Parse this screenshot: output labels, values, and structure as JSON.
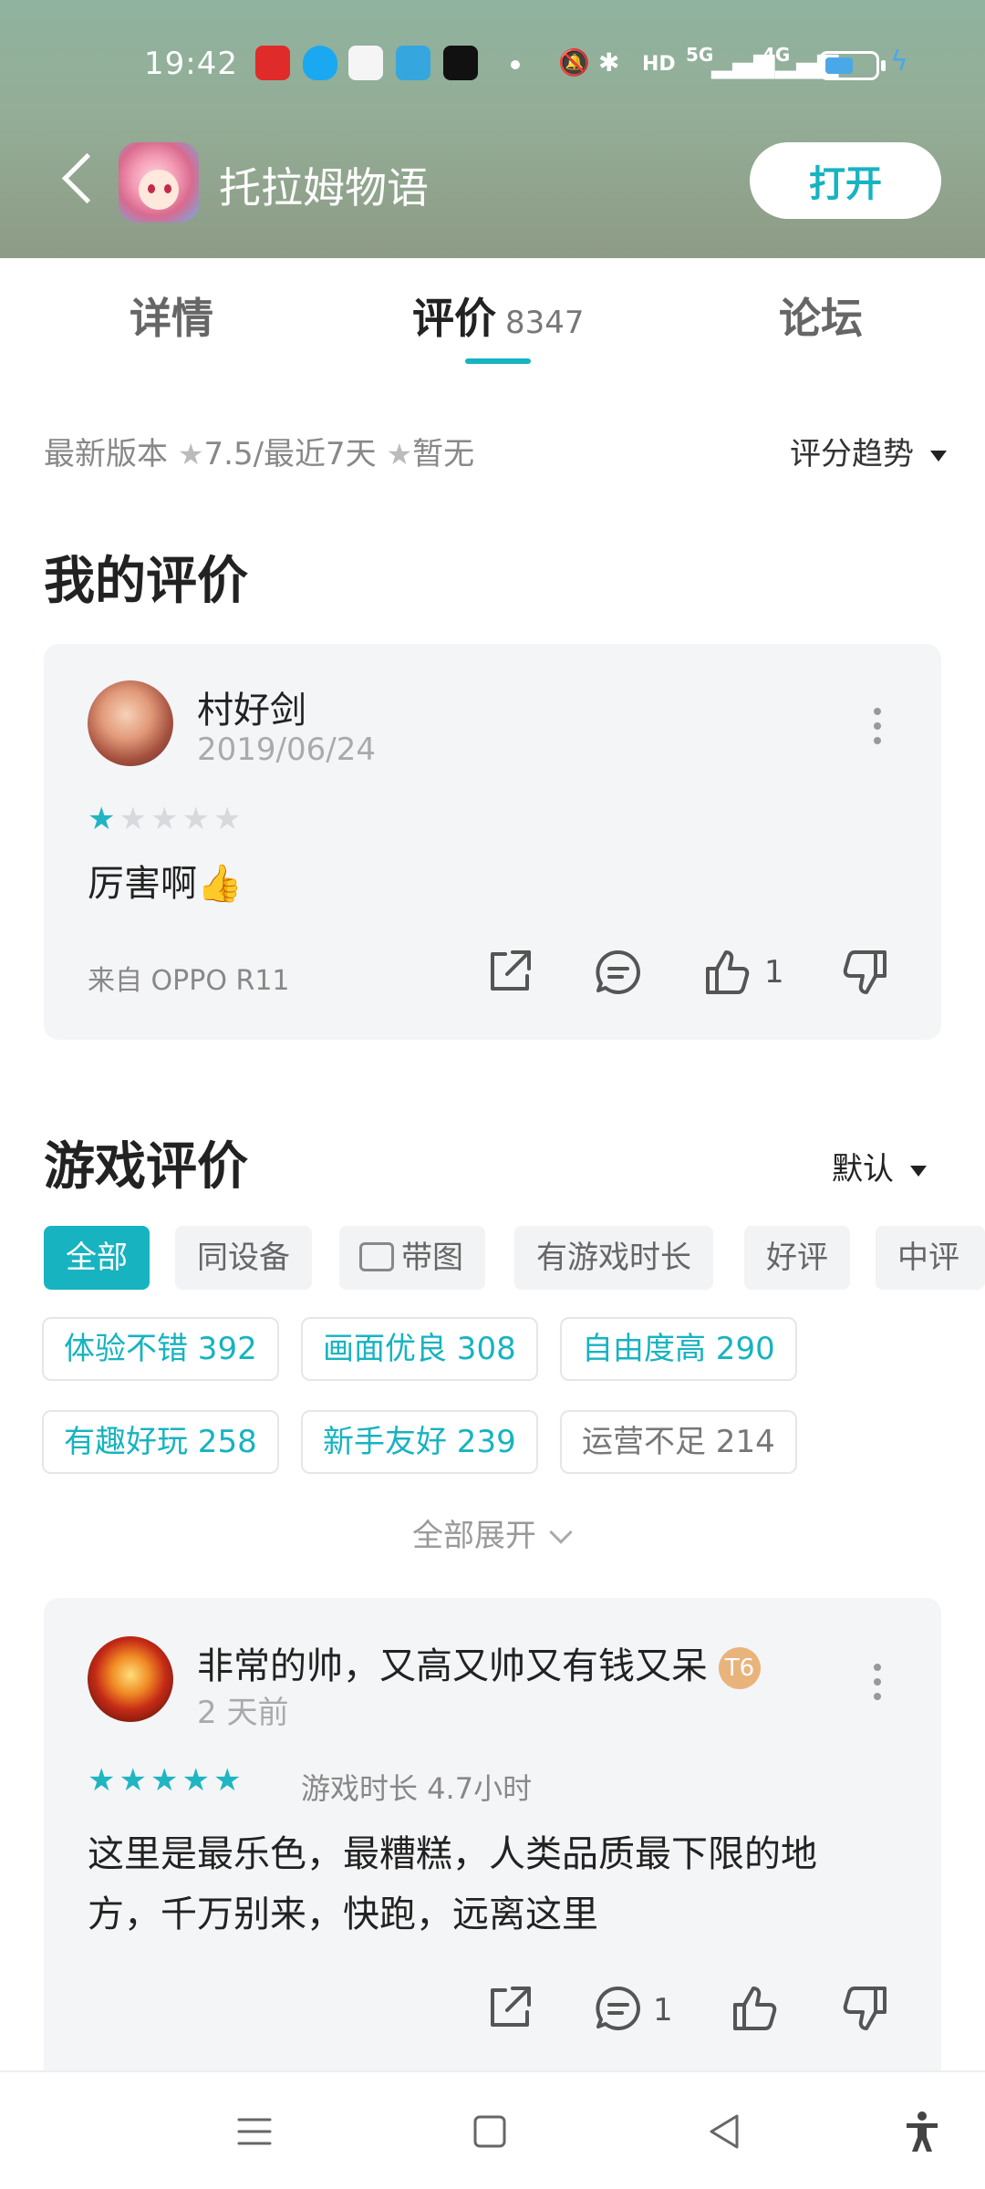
{
  "status_bar": {
    "time": "19:42",
    "network_labels": [
      "HD",
      "5G",
      "4G"
    ],
    "battery_level": 0.55,
    "icons": [
      "app-notif-icon",
      "qq-icon",
      "video-app-icon",
      "telegram-icon",
      "tiktok-icon",
      "mute-icon",
      "bluetooth-icon",
      "signal-icon",
      "battery-icon",
      "charging-icon"
    ]
  },
  "header": {
    "game_title": "托拉姆物语",
    "open_button": "打开"
  },
  "tabs": [
    {
      "label": "详情"
    },
    {
      "label": "评价",
      "count": "8347"
    },
    {
      "label": "论坛"
    }
  ],
  "rating_summary": {
    "latest_label": "最新版本",
    "latest_score": "7.5",
    "recent_label": "/最近7天",
    "recent_score": "暂无",
    "trend_label": "评分趋势"
  },
  "my_review": {
    "section_title": "我的评价",
    "username": "村好剑",
    "date": "2019/06/24",
    "stars": 1,
    "text": "厉害啊👍",
    "device": "来自 OPPO R11",
    "like_count": "1"
  },
  "game_reviews": {
    "section_title": "游戏评价",
    "sort_label": "默认",
    "filters": [
      "全部",
      "同设备",
      "带图",
      "有游戏时长",
      "好评",
      "中评"
    ],
    "tags": [
      {
        "label": "体验不错 392",
        "positive": true
      },
      {
        "label": "画面优良 308",
        "positive": true
      },
      {
        "label": "自由度高 290",
        "positive": true
      },
      {
        "label": "有趣好玩 258",
        "positive": true
      },
      {
        "label": "新手友好 239",
        "positive": true
      },
      {
        "label": "运营不足 214",
        "positive": false
      }
    ],
    "expand_label": "全部展开"
  },
  "review_1": {
    "username": "非常的帅，又高又帅又有钱又呆",
    "badge": "T6",
    "date": "2 天前",
    "stars": 5,
    "playtime": "游戏时长 4.7小时",
    "text_line1": "这里是最乐色，最糟糕，人类品质最下限的地",
    "text_line2": "方，千万别来，快跑，远离这里",
    "comment_count": "1"
  },
  "colors": {
    "accent": "#17b3c0",
    "header_bg": "#94ad96"
  }
}
